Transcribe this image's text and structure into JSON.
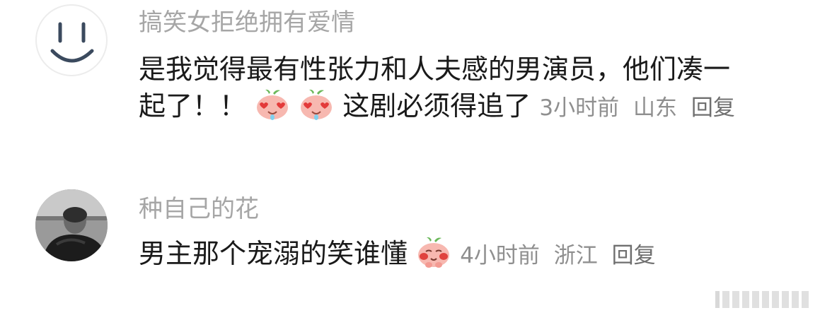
{
  "comments": [
    {
      "username": "搞笑女拒绝拥有爱情",
      "avatar_icon": "smiley-face-icon",
      "text_line1": "是我觉得最有性张力和人夫感的男演员，他们凑一",
      "text_line2_start": "起了！！",
      "emoji_1": "heart-eyes-peach-emoji",
      "emoji_2": "heart-eyes-peach-emoji",
      "text_line2_end": "这剧必须得追了",
      "time": "3小时前",
      "location": "山东",
      "reply_label": "回复"
    },
    {
      "username": "种自己的花",
      "avatar_icon": "user-photo-avatar",
      "text": "男主那个宠溺的笑谁懂",
      "emoji": "blushing-peach-emoji",
      "time": "4小时前",
      "location": "浙江",
      "reply_label": "回复"
    }
  ],
  "colors": {
    "username": "#a6a6a6",
    "body_text": "#1a1a1a",
    "meta": "#8f8f8f",
    "peach": "#f7b8b0"
  }
}
